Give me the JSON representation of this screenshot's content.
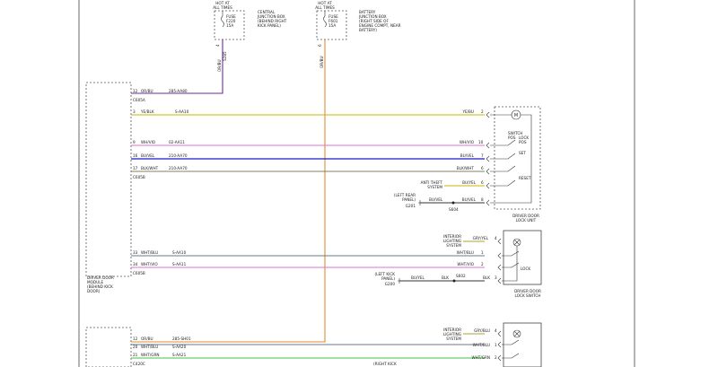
{
  "fuses": [
    {
      "hot_label_1": "HOT AT",
      "hot_label_2": "ALL TIMES",
      "fuse_label": "FUSE",
      "fuse_id": "F220",
      "amps": "15A",
      "box_1": "CENTRAL",
      "box_2": "JUNCTION BOX",
      "box_3": "(BEHIND RIGHT",
      "box_4": "KICK PANEL)"
    },
    {
      "hot_label_1": "HOT AT",
      "hot_label_2": "ALL TIMES",
      "fuse_label": "FUSE",
      "fuse_id": "F601",
      "amps": "15A",
      "box_1": "BATTERY",
      "box_2": "JUNCTION BOX",
      "box_3": "(RIGHT SIDE OF",
      "box_4": "ENGINE COMPT, NEAR",
      "box_5": "BATTERY)"
    }
  ],
  "drops": [
    {
      "pin": "4",
      "color": "OR/BU",
      "circuit": "S285"
    },
    {
      "pin": "6",
      "color": "OR/BU"
    }
  ],
  "module": {
    "label_1": "DRIVER DOOR",
    "label_2": "MODULE",
    "label_3": "(BEHIND KICK",
    "label_4": "DOOR)"
  },
  "power_wire": {
    "pin": "12",
    "color": "OR/BU",
    "circuit": "285-AA80",
    "connector": "C605A"
  },
  "wires_top": [
    {
      "pin": "3",
      "color": "YE/BLK",
      "circuit": "S-AA10",
      "right_color": "YE/BU",
      "right_pin": "2",
      "hex": "#c8b400"
    },
    {
      "pin": "9",
      "color": "WH/VIO",
      "circuit": "02-AA11",
      "right_color": "WH/VIO",
      "right_pin": "10",
      "hex": "#e070d0"
    },
    {
      "pin": "16",
      "color": "BU/VEL",
      "circuit": "210-AA70",
      "right_color": "BU/VEL",
      "right_pin": "7",
      "hex": "#1a1ac8"
    },
    {
      "pin": "17",
      "color": "BLK/WHT",
      "circuit": "210-AA70",
      "right_color": "BLK/WHT",
      "right_pin": "6",
      "hex": "#808060"
    }
  ],
  "connector_top": "C605B",
  "lock_unit": {
    "switch_1": "SWITCH",
    "switch_2": "POS",
    "lock_pos": "LOCK",
    "lock_pos_2": "POS",
    "set": "SET",
    "reset": "RESET",
    "label_1": "DRIVER DOOR",
    "label_2": "LOCK UNIT"
  },
  "anti_theft": {
    "label_1": "ANTI THEFT",
    "label_2": "SYSTEM",
    "right_color": "BU/YEL",
    "right_pin": "6"
  },
  "ground_top": {
    "label_1": "(LEFT REAR",
    "label_2": "PANEL)",
    "ground": "G201",
    "color": "BU/VEL",
    "splice": "S604",
    "right_color": "BU/VEL",
    "right_pin": "8"
  },
  "wires_mid": [
    {
      "pin": "33",
      "color": "WHT/BLU",
      "circuit": "S-AA10",
      "right_color": "WHT/BLU",
      "right_pin": "1",
      "hex": "#6a7a8a"
    },
    {
      "pin": "34",
      "color": "WHT/VIO",
      "circuit": "S-AA11",
      "right_color": "WHT/VIO",
      "right_pin": "2",
      "hex": "#e070d0"
    }
  ],
  "connector_mid": "C605B",
  "lock_switch": {
    "interior_1": "INTERIOR",
    "interior_2": "LIGHTING",
    "interior_3": "SYSTEM",
    "dim_color": "GRY/YEL",
    "dim_pin": "4",
    "lock": "LOCK",
    "label_1": "DRIVER DOOR",
    "label_2": "LOCK SWITCH"
  },
  "ground_mid": {
    "label_1": "(LEFT KICK",
    "label_2": "PANEL)",
    "ground": "G200",
    "color_1": "BU/YEL",
    "color_2": "BLK",
    "splice": "S602",
    "right_color": "BLK",
    "right_pin": "3"
  },
  "bottom": {
    "pin_a": "12",
    "color_a": "OR/BU",
    "circuit_a": "285-SH01",
    "pin_b": "20",
    "color_b": "WHT/BLU",
    "circuit_b": "S-AA20",
    "pin_c": "21",
    "color_c": "WHT/GRN",
    "circuit_c": "S-AA21",
    "connector": "C420C",
    "note": "(RIGHT KICK",
    "interior_1": "INTERIOR",
    "interior_2": "LIGHTING",
    "interior_3": "SYSTEM",
    "right_a_color": "GRY/BLU",
    "right_a_pin": "4",
    "right_b_color": "WHT/BLU",
    "right_b_pin": "1",
    "right_c_color": "WHT/GRN",
    "right_c_pin": "2"
  },
  "colors": {
    "orange_wire": "#e08c30",
    "purple_wire": "#6a2a9a",
    "green_wire": "#40c040"
  }
}
